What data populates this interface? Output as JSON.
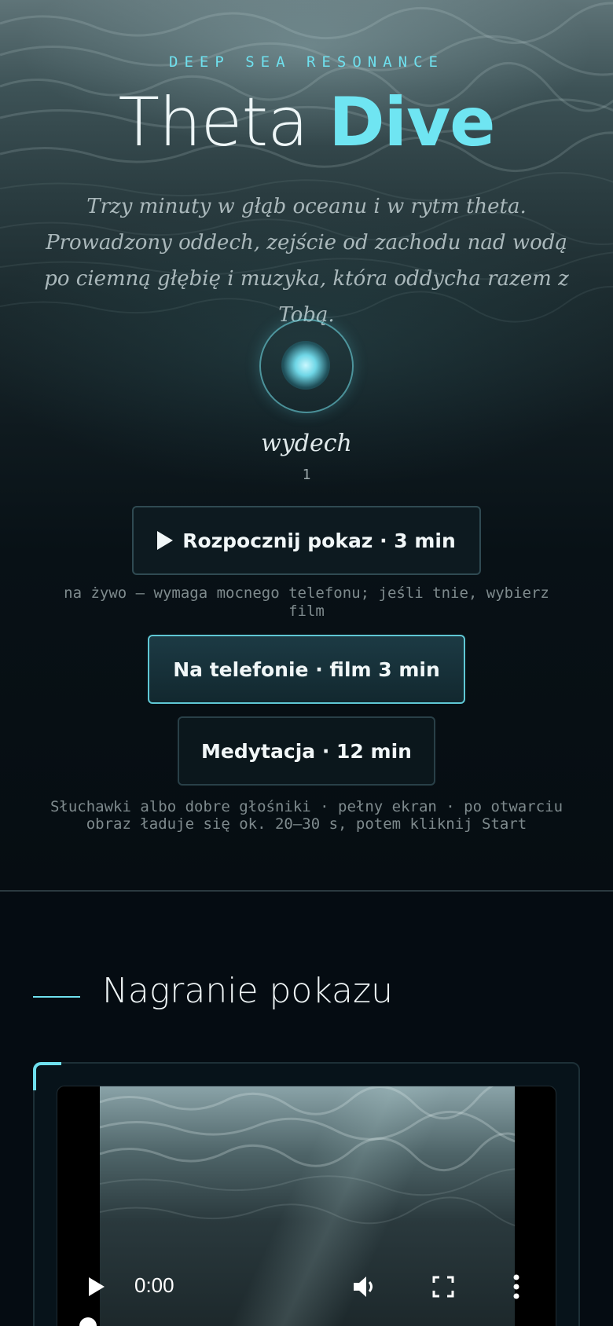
{
  "hero": {
    "eyebrow": "DEEP SEA RESONANCE",
    "title_main": "Theta",
    "title_accent": "Dive",
    "intro": "Trzy minuty w głąb oceanu i w rytm theta. Prowadzony oddech, zejście od zachodu nad wodą po ciemną głębię i muzyka, która oddycha razem z Tobą."
  },
  "breath": {
    "phase": "wydech",
    "count": "1"
  },
  "actions": {
    "start_label": "Rozpocznij pokaz · 3 min",
    "start_hint": "na żywo — wymaga mocnego telefonu; jeśli tnie, wybierz film",
    "phone_label": "Na telefonie · film 3 min",
    "meditation_label": "Medytacja · 12 min",
    "footer_hint": "Słuchawki albo dobre głośniki · pełny ekran · po otwarciu obraz ładuje się ok. 20–30 s, potem kliknij Start"
  },
  "recording": {
    "section_title": "Nagranie pokazu",
    "player": {
      "time": "0:00",
      "icons": [
        "play-icon",
        "volume-icon",
        "fullscreen-icon",
        "more-options-icon"
      ]
    }
  },
  "colors": {
    "accent": "#6fe0ee",
    "background": "#050c12",
    "text": "#eef6f7"
  }
}
